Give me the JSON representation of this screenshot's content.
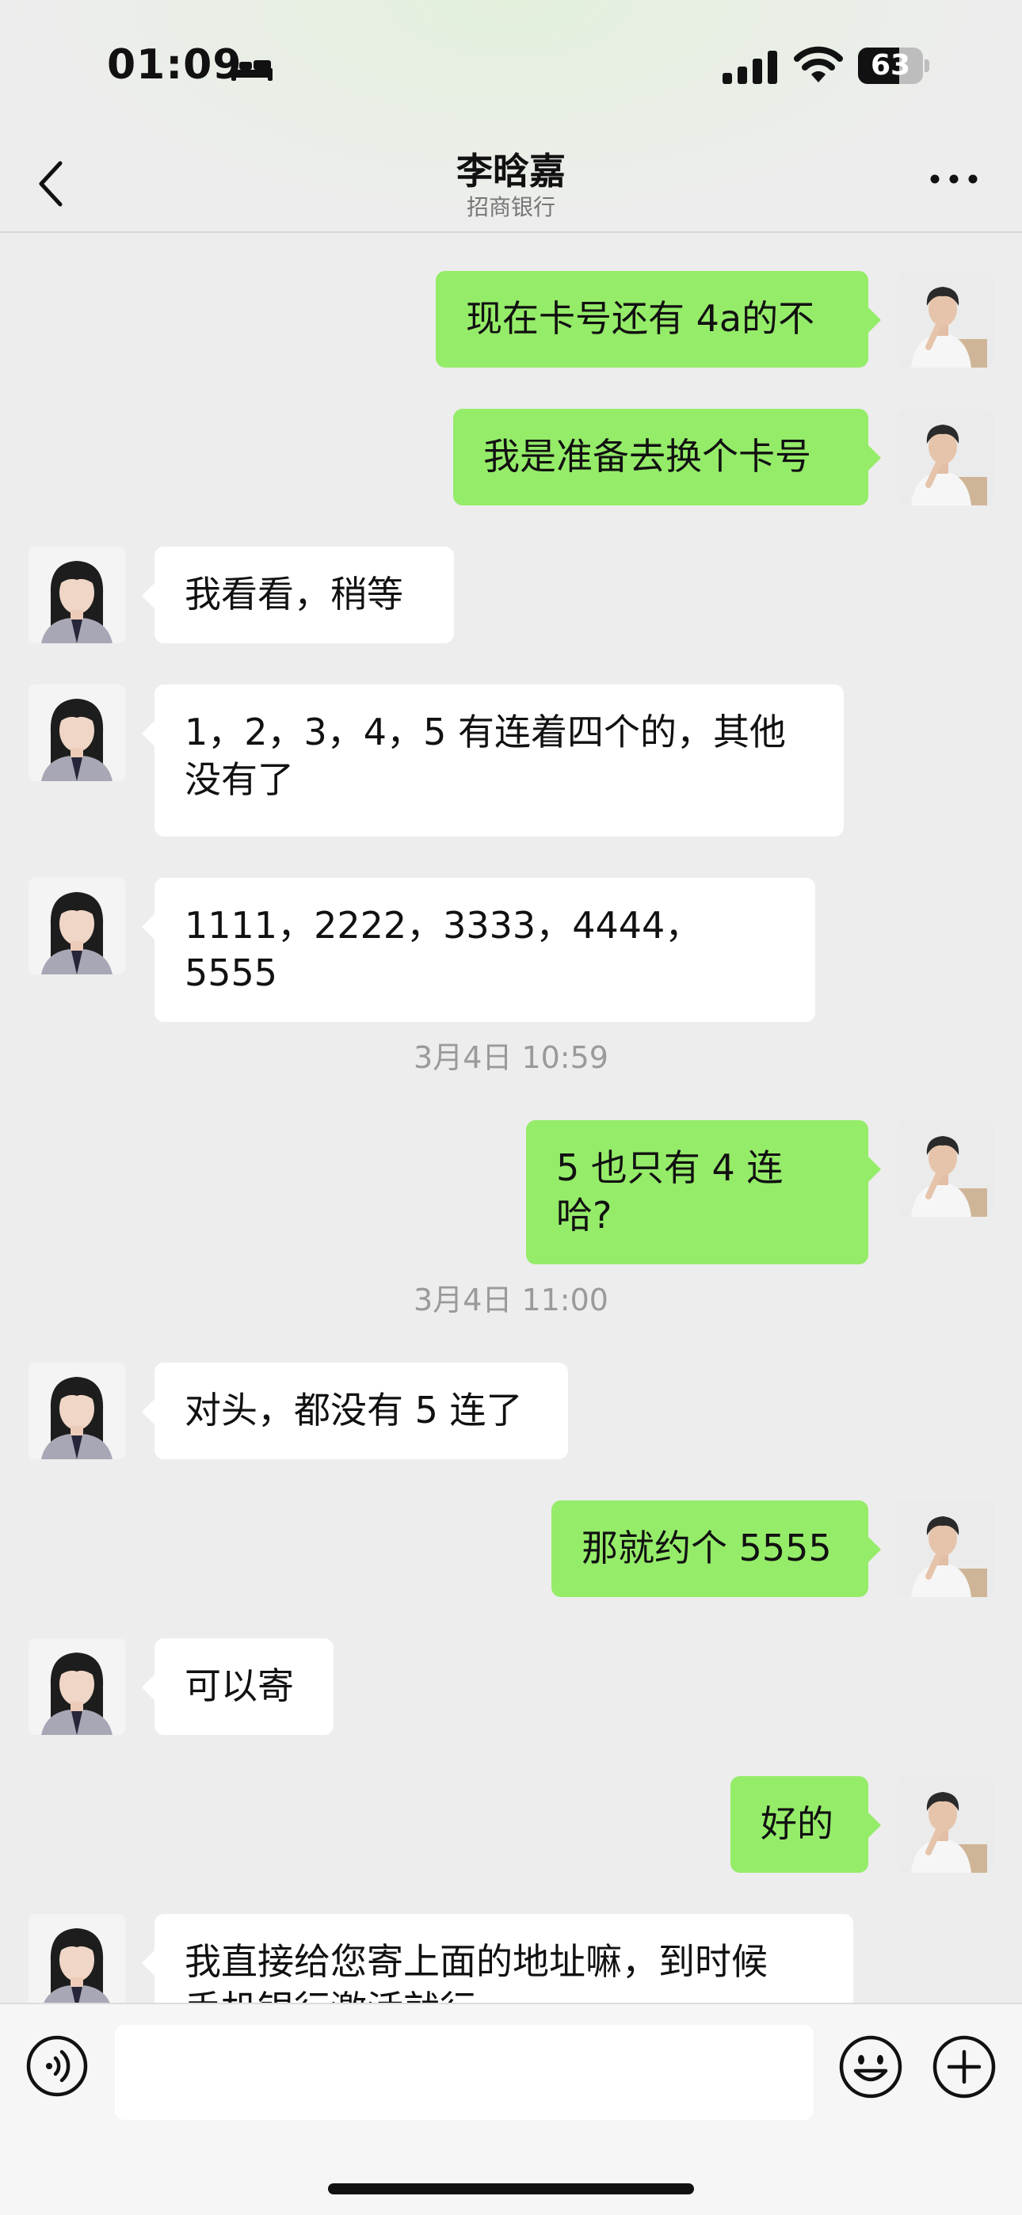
{
  "status_bar": {
    "time": "01:09",
    "battery_text": "63",
    "battery_level_percent": 63,
    "icons": [
      "bed-icon",
      "cellular-signal-icon",
      "wifi-icon",
      "battery-icon"
    ]
  },
  "nav": {
    "title": "李晗嘉",
    "subtitle": "招商银行",
    "icons": [
      "back-chevron-icon",
      "more-dots-icon"
    ]
  },
  "colors": {
    "background": "#ededed",
    "sent_bubble": "#95ec69",
    "received_bubble": "#ffffff",
    "timestamp_text": "#9a9a9a"
  },
  "messages": [
    {
      "sender": "self",
      "text": "现在卡号还有 4a的不"
    },
    {
      "sender": "self",
      "text": "我是准备去换个卡号"
    },
    {
      "sender": "contact",
      "text": "我看看，稍等"
    },
    {
      "sender": "contact",
      "text": "1，2，3，4，5 有连着四个的，其他\n没有了"
    },
    {
      "sender": "contact",
      "text": "1111，2222，3333，4444，5555"
    },
    {
      "type": "timestamp",
      "text": "3月4日 10:59"
    },
    {
      "sender": "self",
      "text": "5 也只有 4 连哈?"
    },
    {
      "type": "timestamp",
      "text": "3月4日 11:00"
    },
    {
      "sender": "contact",
      "text": "对头，都没有 5 连了"
    },
    {
      "sender": "self",
      "text": "那就约个 5555"
    },
    {
      "sender": "contact",
      "text": "可以寄"
    },
    {
      "sender": "self",
      "text": "好的"
    },
    {
      "sender": "contact",
      "text": "我直接给您寄上面的地址嘛，到时候\n手机银行激活就行"
    }
  ],
  "input_bar": {
    "message_value": "",
    "icons": [
      "voice-icon",
      "emoji-icon",
      "plus-icon"
    ]
  }
}
